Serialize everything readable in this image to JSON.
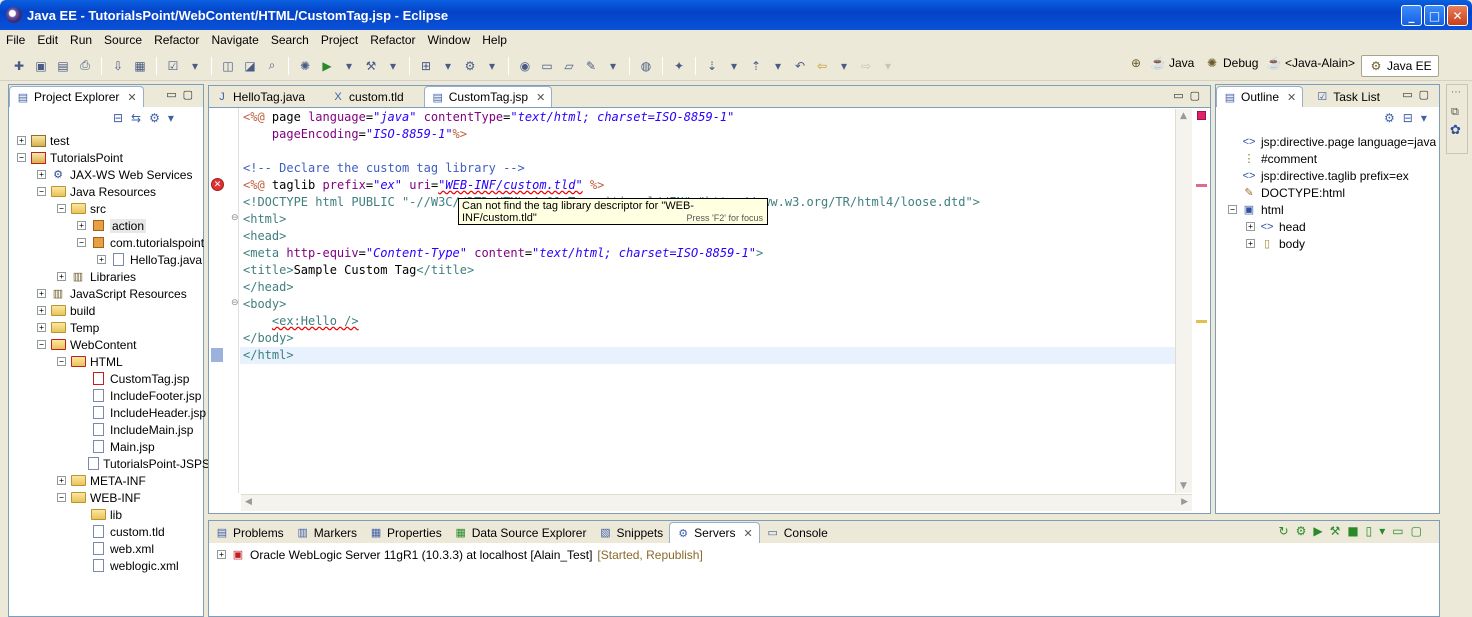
{
  "window": {
    "title": "Java EE - TutorialsPoint/WebContent/HTML/CustomTag.jsp - Eclipse",
    "controls": [
      "_",
      "□",
      "✕"
    ]
  },
  "menu": [
    "File",
    "Edit",
    "Run",
    "Source",
    "Refactor",
    "Navigate",
    "Search",
    "Project",
    "Refactor",
    "Window",
    "Help"
  ],
  "perspectives": {
    "java": "Java",
    "debug": "Debug",
    "java_alain": "<Java-Alain>",
    "java_ee": "Java EE"
  },
  "project_explorer": {
    "title": "Project Explorer",
    "items": [
      {
        "label": "test",
        "icon": "project-icon"
      },
      {
        "label": "TutorialsPoint",
        "icon": "project-error-icon"
      },
      {
        "label": "JAX-WS Web Services",
        "icon": "webservice-icon"
      },
      {
        "label": "Java Resources",
        "icon": "java-resources-icon"
      },
      {
        "label": "src",
        "icon": "folder-icon"
      },
      {
        "label": "action",
        "icon": "package-icon"
      },
      {
        "label": "com.tutorialspoint",
        "icon": "package-icon"
      },
      {
        "label": "HelloTag.java",
        "icon": "java-file-icon"
      },
      {
        "label": "Libraries",
        "icon": "library-icon"
      },
      {
        "label": "JavaScript Resources",
        "icon": "js-resources-icon"
      },
      {
        "label": "build",
        "icon": "folder-icon"
      },
      {
        "label": "Temp",
        "icon": "folder-icon"
      },
      {
        "label": "WebContent",
        "icon": "folder-error-icon"
      },
      {
        "label": "HTML",
        "icon": "folder-error-icon"
      },
      {
        "label": "CustomTag.jsp",
        "icon": "jsp-error-icon"
      },
      {
        "label": "IncludeFooter.jsp",
        "icon": "jsp-file-icon"
      },
      {
        "label": "IncludeHeader.jsp",
        "icon": "jsp-file-icon"
      },
      {
        "label": "IncludeMain.jsp",
        "icon": "jsp-file-icon"
      },
      {
        "label": "Main.jsp",
        "icon": "jsp-file-icon"
      },
      {
        "label": "TutorialsPoint-JSPS",
        "icon": "jsp-file-icon"
      },
      {
        "label": "META-INF",
        "icon": "folder-icon"
      },
      {
        "label": "WEB-INF",
        "icon": "folder-icon"
      },
      {
        "label": "lib",
        "icon": "folder-icon"
      },
      {
        "label": "custom.tld",
        "icon": "tld-file-icon"
      },
      {
        "label": "web.xml",
        "icon": "xml-file-icon"
      },
      {
        "label": "weblogic.xml",
        "icon": "xml-file-icon"
      }
    ]
  },
  "editor": {
    "tabs": [
      "HelloTag.java",
      "custom.tld",
      "CustomTag.jsp"
    ],
    "active_tab": "CustomTag.jsp",
    "lines": [
      "<%@ page language=\"java\" contentType=\"text/html; charset=ISO-8859-1\"",
      "    pageEncoding=\"ISO-8859-1\"%>",
      "",
      "<!-- Declare the custom tag library -->",
      "<%@ taglib prefix=\"ex\" uri=\"WEB-INF/custom.tld\" %>",
      "<!DOCTYPE html PUBLIC \"-//W3C//DTD HTML 4.01 Transitional//EN\" \"http://www.w3.org/TR/html4/loose.dtd\">",
      "<html>",
      "<head>",
      "<meta http-equiv=\"Content-Type\" content=\"text/html; charset=ISO-8859-1\">",
      "<title>Sample Custom Tag</title>",
      "</head>",
      "<body>",
      "    <ex:Hello />",
      "</body>",
      "</html>"
    ],
    "tooltip": {
      "message": "Can not find the tag library descriptor for \"WEB-INF/custom.tld\"",
      "hint": "Press 'F2' for focus"
    }
  },
  "outline": {
    "tabs": [
      "Outline",
      "Task List"
    ],
    "items": [
      {
        "label": "jsp:directive.page language=java",
        "icon": "element-icon"
      },
      {
        "label": "#comment",
        "icon": "comment-icon"
      },
      {
        "label": "jsp:directive.taglib prefix=ex",
        "icon": "element-icon"
      },
      {
        "label": "DOCTYPE:html",
        "icon": "doctype-icon"
      },
      {
        "label": "html",
        "icon": "element-icon"
      },
      {
        "label": "head",
        "icon": "element-icon"
      },
      {
        "label": "body",
        "icon": "element-icon"
      }
    ]
  },
  "bottom": {
    "tabs": [
      "Problems",
      "Markers",
      "Properties",
      "Data Source Explorer",
      "Snippets",
      "Servers",
      "Console"
    ],
    "active_tab": "Servers",
    "server": {
      "name": "Oracle WebLogic Server 11gR1 (10.3.3) at localhost [Alain_Test]",
      "status": "[Started, Republish]"
    }
  },
  "colors": {
    "title_bar": "#0a52d8",
    "jsp_tag": "#bf5f3f",
    "attribute": "#7f007f",
    "string": "#2a00ff",
    "comment": "#3f5fbf",
    "error": "#e03030",
    "server_status": "#8a6a2a"
  }
}
